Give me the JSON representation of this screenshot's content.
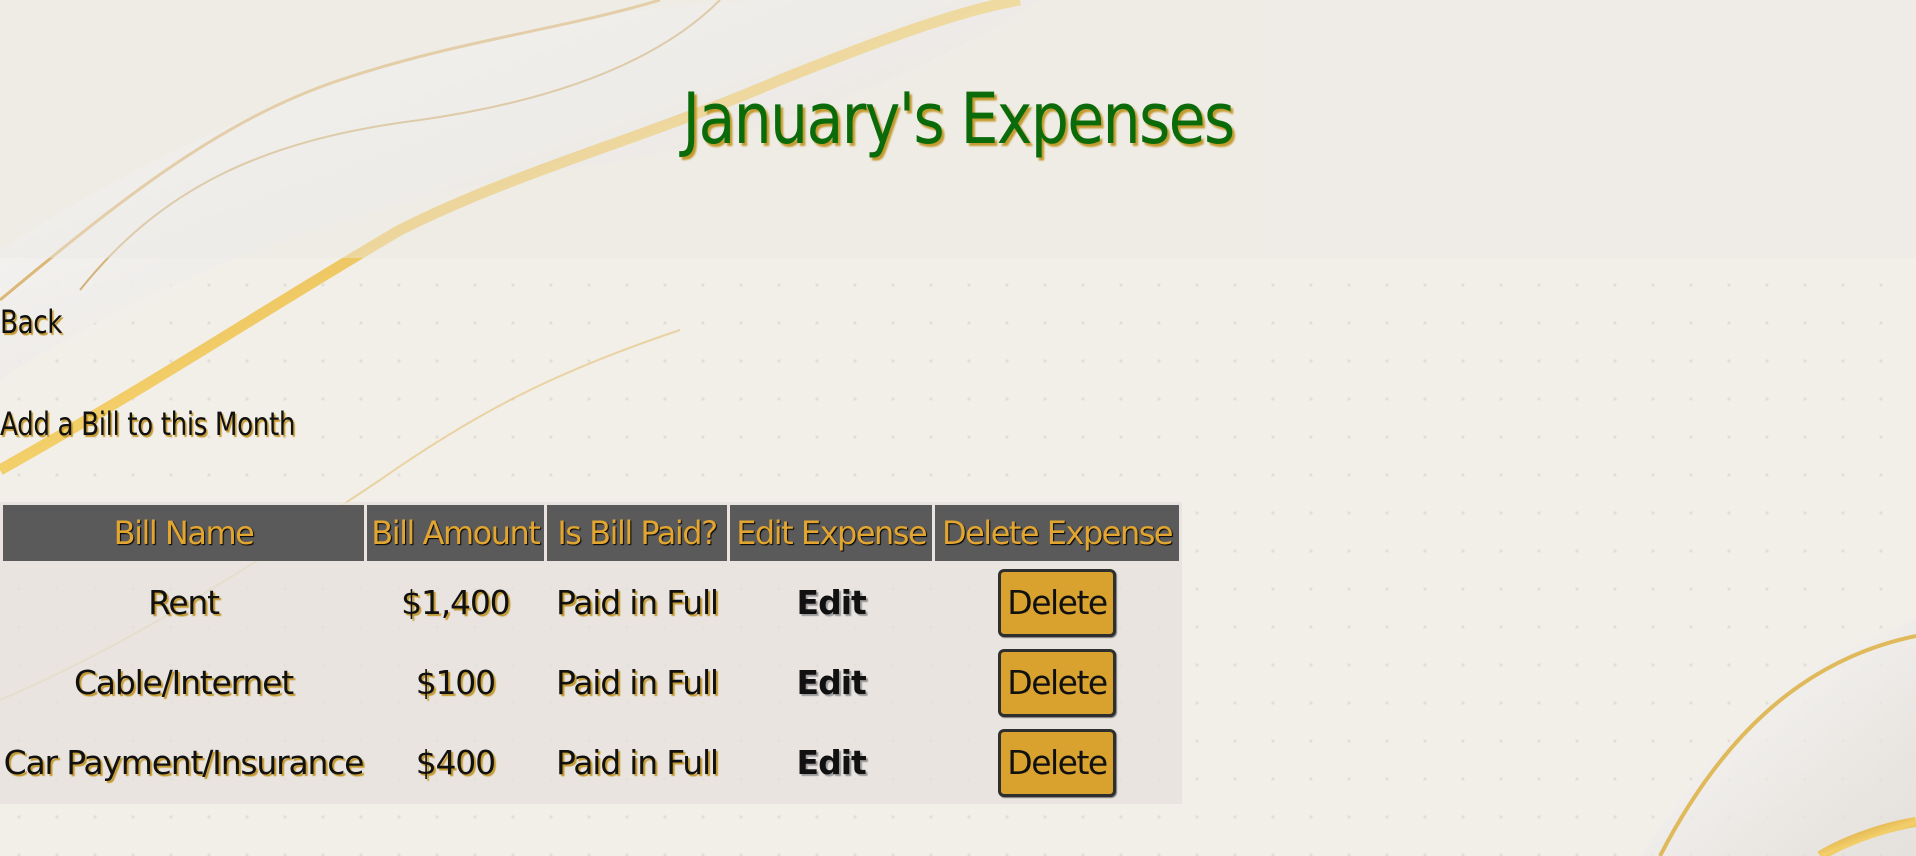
{
  "page": {
    "title": "January's Expenses"
  },
  "nav": {
    "back_label": "Back",
    "add_bill_label": "Add a Bill to this Month"
  },
  "table": {
    "headers": [
      "Bill Name",
      "Bill Amount",
      "Is Bill Paid?",
      "Edit Expense",
      "Delete Expense"
    ],
    "rows": [
      {
        "name": "Rent",
        "amount": "$1,400",
        "status": "Paid in Full",
        "edit_label": "Edit",
        "delete_label": "Delete"
      },
      {
        "name": "Cable/Internet",
        "amount": "$100",
        "status": "Paid in Full",
        "edit_label": "Edit",
        "delete_label": "Delete"
      },
      {
        "name": "Car Payment/Insurance",
        "amount": "$400",
        "status": "Paid in Full",
        "edit_label": "Edit",
        "delete_label": "Delete"
      }
    ]
  },
  "colors": {
    "title": "#0b6b0b",
    "accent_gold": "#d9a22f",
    "header_bg": "#5b5a5a",
    "header_text": "#e1a530"
  }
}
